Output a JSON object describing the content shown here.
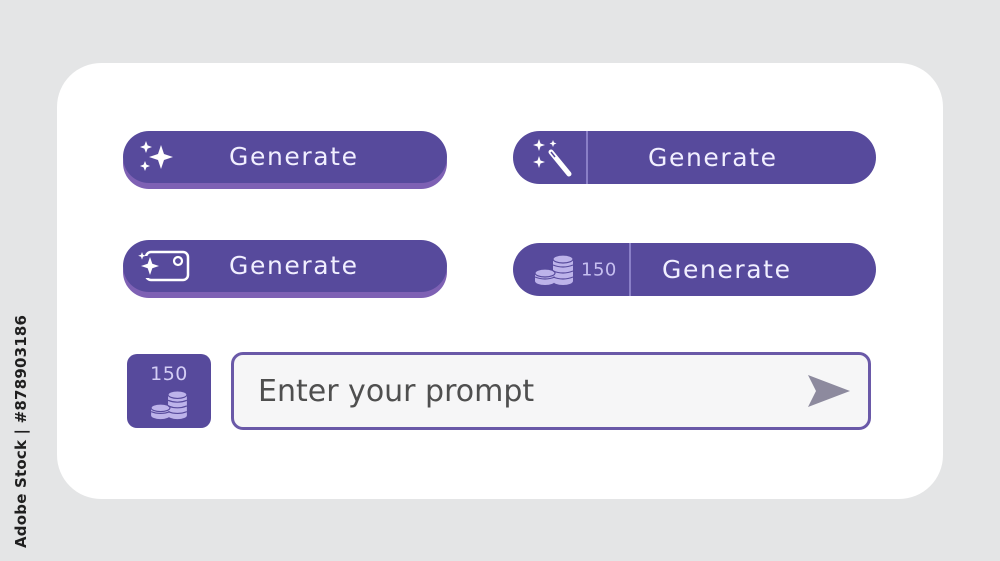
{
  "watermark": {
    "text": "Adobe Stock | #878903186"
  },
  "buttons": [
    {
      "label": "Generate",
      "icon": "sparkles-icon"
    },
    {
      "label": "Generate",
      "icon": "magic-wand-icon"
    },
    {
      "label": "Generate",
      "icon": "sparkle-image-icon"
    },
    {
      "label": "Generate",
      "icon": "coins-icon",
      "count": "150"
    }
  ],
  "credits": {
    "count": "150",
    "icon": "coins-icon"
  },
  "prompt": {
    "placeholder": "Enter your prompt",
    "value": "",
    "send_icon": "send-icon"
  },
  "colors": {
    "button": "#574a9c",
    "button_shadow": "#7e61b4",
    "coin": "#bdb3ea",
    "input_border": "#6a59a8",
    "send_icon": "#8d8a9e"
  }
}
